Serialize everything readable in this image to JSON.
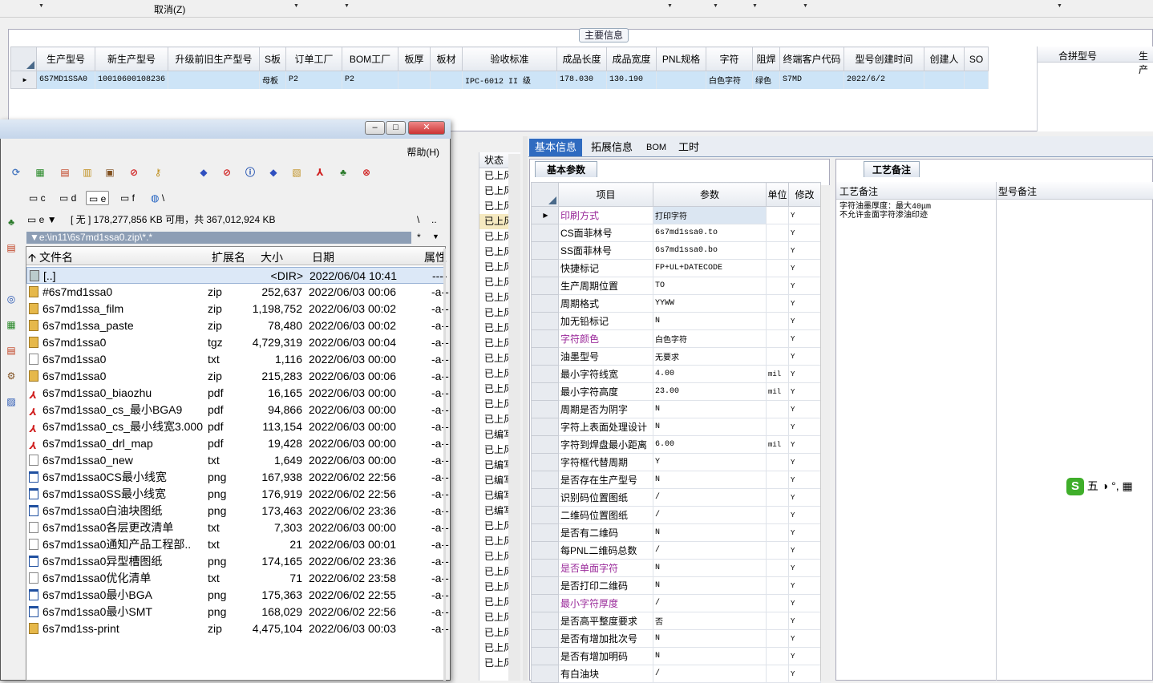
{
  "topbar": {
    "cancel_label": "取消(Z)"
  },
  "main_group": {
    "title": "主要信息",
    "columns": [
      "生产型号",
      "新生产型号",
      "升级前旧生产型号",
      "S板",
      "订单工厂",
      "BOM工厂",
      "板厚",
      "板材",
      "验收标准",
      "成品长度",
      "成品宽度",
      "PNL规格",
      "字符",
      "阻焊",
      "终端客户代码",
      "型号创建时间",
      "创建人",
      "SO"
    ],
    "row": [
      "6S7MD1SSA0",
      "10010600108236",
      "",
      "母板",
      "P2",
      "P2",
      "",
      "",
      "IPC-6012 II 级",
      "178.030",
      "130.190",
      "",
      "白色字符",
      "绿色",
      "S7MD",
      "2022/6/2",
      "",
      ""
    ],
    "merge_header": [
      "合拼型号",
      "生产"
    ]
  },
  "status_column": {
    "header": "状态",
    "cells": [
      "已上风",
      "已上风",
      "已上风",
      "已上风",
      "已上风",
      "已上风",
      "已上风",
      "已上风",
      "已上风",
      "已上风",
      "已上风",
      "已上风",
      "已上风",
      "已上风",
      "已上风",
      "已上风",
      "已上风",
      "已编写",
      "已上风",
      "已编写",
      "已编写",
      "已编写",
      "已编写",
      "已上风",
      "已上风",
      "已上风",
      "已上风",
      "已上风",
      "已上风",
      "已上风",
      "已上风",
      "已上风",
      "已上风"
    ]
  },
  "right_tabs": [
    "基本信息",
    "拓展信息",
    "BOM",
    "工时"
  ],
  "basic_panel": {
    "tab": "基本参数",
    "columns": [
      "项目",
      "参数",
      "单位",
      "修改"
    ],
    "rows": [
      {
        "item": "印刷方式",
        "value": "打印字符",
        "unit": "",
        "mod": "Y",
        "purple": true
      },
      {
        "item": "CS面菲林号",
        "value": "6s7md1ssa0.to",
        "unit": "",
        "mod": "Y"
      },
      {
        "item": "SS面菲林号",
        "value": "6s7md1ssa0.bo",
        "unit": "",
        "mod": "Y"
      },
      {
        "item": "快捷标记",
        "value": "FP+UL+DATECODE",
        "unit": "",
        "mod": "Y"
      },
      {
        "item": "生产周期位置",
        "value": "TO",
        "unit": "",
        "mod": "Y"
      },
      {
        "item": "周期格式",
        "value": "YYWW",
        "unit": "",
        "mod": "Y"
      },
      {
        "item": "加无铅标记",
        "value": "N",
        "unit": "",
        "mod": "Y"
      },
      {
        "item": "字符颜色",
        "value": "白色字符",
        "unit": "",
        "mod": "Y",
        "purple": true
      },
      {
        "item": "油墨型号",
        "value": "无要求",
        "unit": "",
        "mod": "Y"
      },
      {
        "item": "最小字符线宽",
        "value": "4.00",
        "unit": "mil",
        "mod": "Y"
      },
      {
        "item": "最小字符高度",
        "value": "23.00",
        "unit": "mil",
        "mod": "Y"
      },
      {
        "item": "周期是否为阴字",
        "value": "N",
        "unit": "",
        "mod": "Y"
      },
      {
        "item": "字符上表面处理设计",
        "value": "N",
        "unit": "",
        "mod": "Y"
      },
      {
        "item": "字符到焊盘最小距离",
        "value": "6.00",
        "unit": "mil",
        "mod": "Y"
      },
      {
        "item": "字符框代替周期",
        "value": "Y",
        "unit": "",
        "mod": "Y"
      },
      {
        "item": "是否存在生产型号",
        "value": "N",
        "unit": "",
        "mod": "Y"
      },
      {
        "item": "识别码位置图纸",
        "value": "/",
        "unit": "",
        "mod": "Y"
      },
      {
        "item": "二维码位置图纸",
        "value": "/",
        "unit": "",
        "mod": "Y"
      },
      {
        "item": "是否有二维码",
        "value": "N",
        "unit": "",
        "mod": "Y"
      },
      {
        "item": "每PNL二维码总数",
        "value": "/",
        "unit": "",
        "mod": "Y"
      },
      {
        "item": "是否单面字符",
        "value": "N",
        "unit": "",
        "mod": "Y",
        "purple": true
      },
      {
        "item": "是否打印二维码",
        "value": "N",
        "unit": "",
        "mod": "Y"
      },
      {
        "item": "最小字符厚度",
        "value": "/",
        "unit": "",
        "mod": "Y",
        "purple": true
      },
      {
        "item": "是否高平整度要求",
        "value": "否",
        "unit": "",
        "mod": "Y"
      },
      {
        "item": "是否有增加批次号",
        "value": "N",
        "unit": "",
        "mod": "Y"
      },
      {
        "item": "是否有增加明码",
        "value": "N",
        "unit": "",
        "mod": "Y"
      },
      {
        "item": "有白油块",
        "value": "/",
        "unit": "",
        "mod": "Y"
      }
    ]
  },
  "note_panel": {
    "tab": "工艺备注",
    "col1": "工艺备注",
    "col2": "型号备注",
    "text_line1": "字符油墨厚度：最大40μm",
    "text_line2": "不允许金面字符渗油印迹"
  },
  "ime": {
    "text": "五 ◑ °, ▦"
  },
  "file_manager": {
    "menu_help": "帮助(H)",
    "drives": [
      "c",
      "d",
      "e",
      "f",
      "\\"
    ],
    "selected_drive": "e",
    "drive_select": "e",
    "free_space": "[ 无 ] 178,277,856 KB 可用，共 367,012,924 KB",
    "path_right1": "\\",
    "path_right2": "..",
    "path": "e:\\in11\\6s7md1ssa0.zip\\*.*",
    "path_star": "*",
    "headers": {
      "name": "文件名",
      "ext": "扩展名",
      "size": "大小",
      "date": "日期",
      "attr": "属性"
    },
    "files": [
      {
        "name": "[..]",
        "ext": "",
        "size": "<DIR>",
        "date": "2022/06/04 10:41",
        "attr": "----",
        "type": "up"
      },
      {
        "name": "#6s7md1ssa0",
        "ext": "zip",
        "size": "252,637",
        "date": "2022/06/03 00:06",
        "attr": "-a--",
        "type": "zip"
      },
      {
        "name": "6s7md1ssa_film",
        "ext": "zip",
        "size": "1,198,752",
        "date": "2022/06/03 00:02",
        "attr": "-a--",
        "type": "zip"
      },
      {
        "name": "6s7md1ssa_paste",
        "ext": "zip",
        "size": "78,480",
        "date": "2022/06/03 00:02",
        "attr": "-a--",
        "type": "zip"
      },
      {
        "name": "6s7md1ssa0",
        "ext": "tgz",
        "size": "4,729,319",
        "date": "2022/06/03 00:04",
        "attr": "-a--",
        "type": "zip"
      },
      {
        "name": "6s7md1ssa0",
        "ext": "txt",
        "size": "1,116",
        "date": "2022/06/03 00:00",
        "attr": "-a--",
        "type": "txt"
      },
      {
        "name": "6s7md1ssa0",
        "ext": "zip",
        "size": "215,283",
        "date": "2022/06/03 00:06",
        "attr": "-a--",
        "type": "zip"
      },
      {
        "name": "6s7md1ssa0_biaozhu",
        "ext": "pdf",
        "size": "16,165",
        "date": "2022/06/03 00:00",
        "attr": "-a--",
        "type": "pdf"
      },
      {
        "name": "6s7md1ssa0_cs_最小BGA9",
        "ext": "pdf",
        "size": "94,866",
        "date": "2022/06/03 00:00",
        "attr": "-a--",
        "type": "pdf"
      },
      {
        "name": "6s7md1ssa0_cs_最小线宽3.000",
        "ext": "pdf",
        "size": "113,154",
        "date": "2022/06/03 00:00",
        "attr": "-a--",
        "type": "pdf"
      },
      {
        "name": "6s7md1ssa0_drl_map",
        "ext": "pdf",
        "size": "19,428",
        "date": "2022/06/03 00:00",
        "attr": "-a--",
        "type": "pdf"
      },
      {
        "name": "6s7md1ssa0_new",
        "ext": "txt",
        "size": "1,649",
        "date": "2022/06/03 00:00",
        "attr": "-a--",
        "type": "txt"
      },
      {
        "name": "6s7md1ssa0CS最小线宽",
        "ext": "png",
        "size": "167,938",
        "date": "2022/06/02 22:56",
        "attr": "-a--",
        "type": "png"
      },
      {
        "name": "6s7md1ssa0SS最小线宽",
        "ext": "png",
        "size": "176,919",
        "date": "2022/06/02 22:56",
        "attr": "-a--",
        "type": "png"
      },
      {
        "name": "6s7md1ssa0白油块图纸",
        "ext": "png",
        "size": "173,463",
        "date": "2022/06/02 23:36",
        "attr": "-a--",
        "type": "png"
      },
      {
        "name": "6s7md1ssa0各层更改清单",
        "ext": "txt",
        "size": "7,303",
        "date": "2022/06/03 00:00",
        "attr": "-a--",
        "type": "txt"
      },
      {
        "name": "6s7md1ssa0通知产品工程部..",
        "ext": "txt",
        "size": "21",
        "date": "2022/06/03 00:01",
        "attr": "-a--",
        "type": "txt"
      },
      {
        "name": "6s7md1ssa0异型槽图纸",
        "ext": "png",
        "size": "174,165",
        "date": "2022/06/02 23:36",
        "attr": "-a--",
        "type": "png"
      },
      {
        "name": "6s7md1ssa0优化清单",
        "ext": "txt",
        "size": "71",
        "date": "2022/06/02 23:58",
        "attr": "-a--",
        "type": "txt"
      },
      {
        "name": "6s7md1ssa0最小BGA",
        "ext": "png",
        "size": "175,363",
        "date": "2022/06/02 22:55",
        "attr": "-a--",
        "type": "png"
      },
      {
        "name": "6s7md1ssa0最小SMT",
        "ext": "png",
        "size": "168,029",
        "date": "2022/06/02 22:56",
        "attr": "-a--",
        "type": "png"
      },
      {
        "name": "6s7md1ss-print",
        "ext": "zip",
        "size": "4,475,104",
        "date": "2022/06/03 00:03",
        "attr": "-a--",
        "type": "zip"
      }
    ]
  },
  "colors": {
    "selection": "#cde4f7",
    "tab_active": "#2f6bc0",
    "purple_label": "#9a2a9a",
    "path_bar": "#8d9eb5"
  }
}
